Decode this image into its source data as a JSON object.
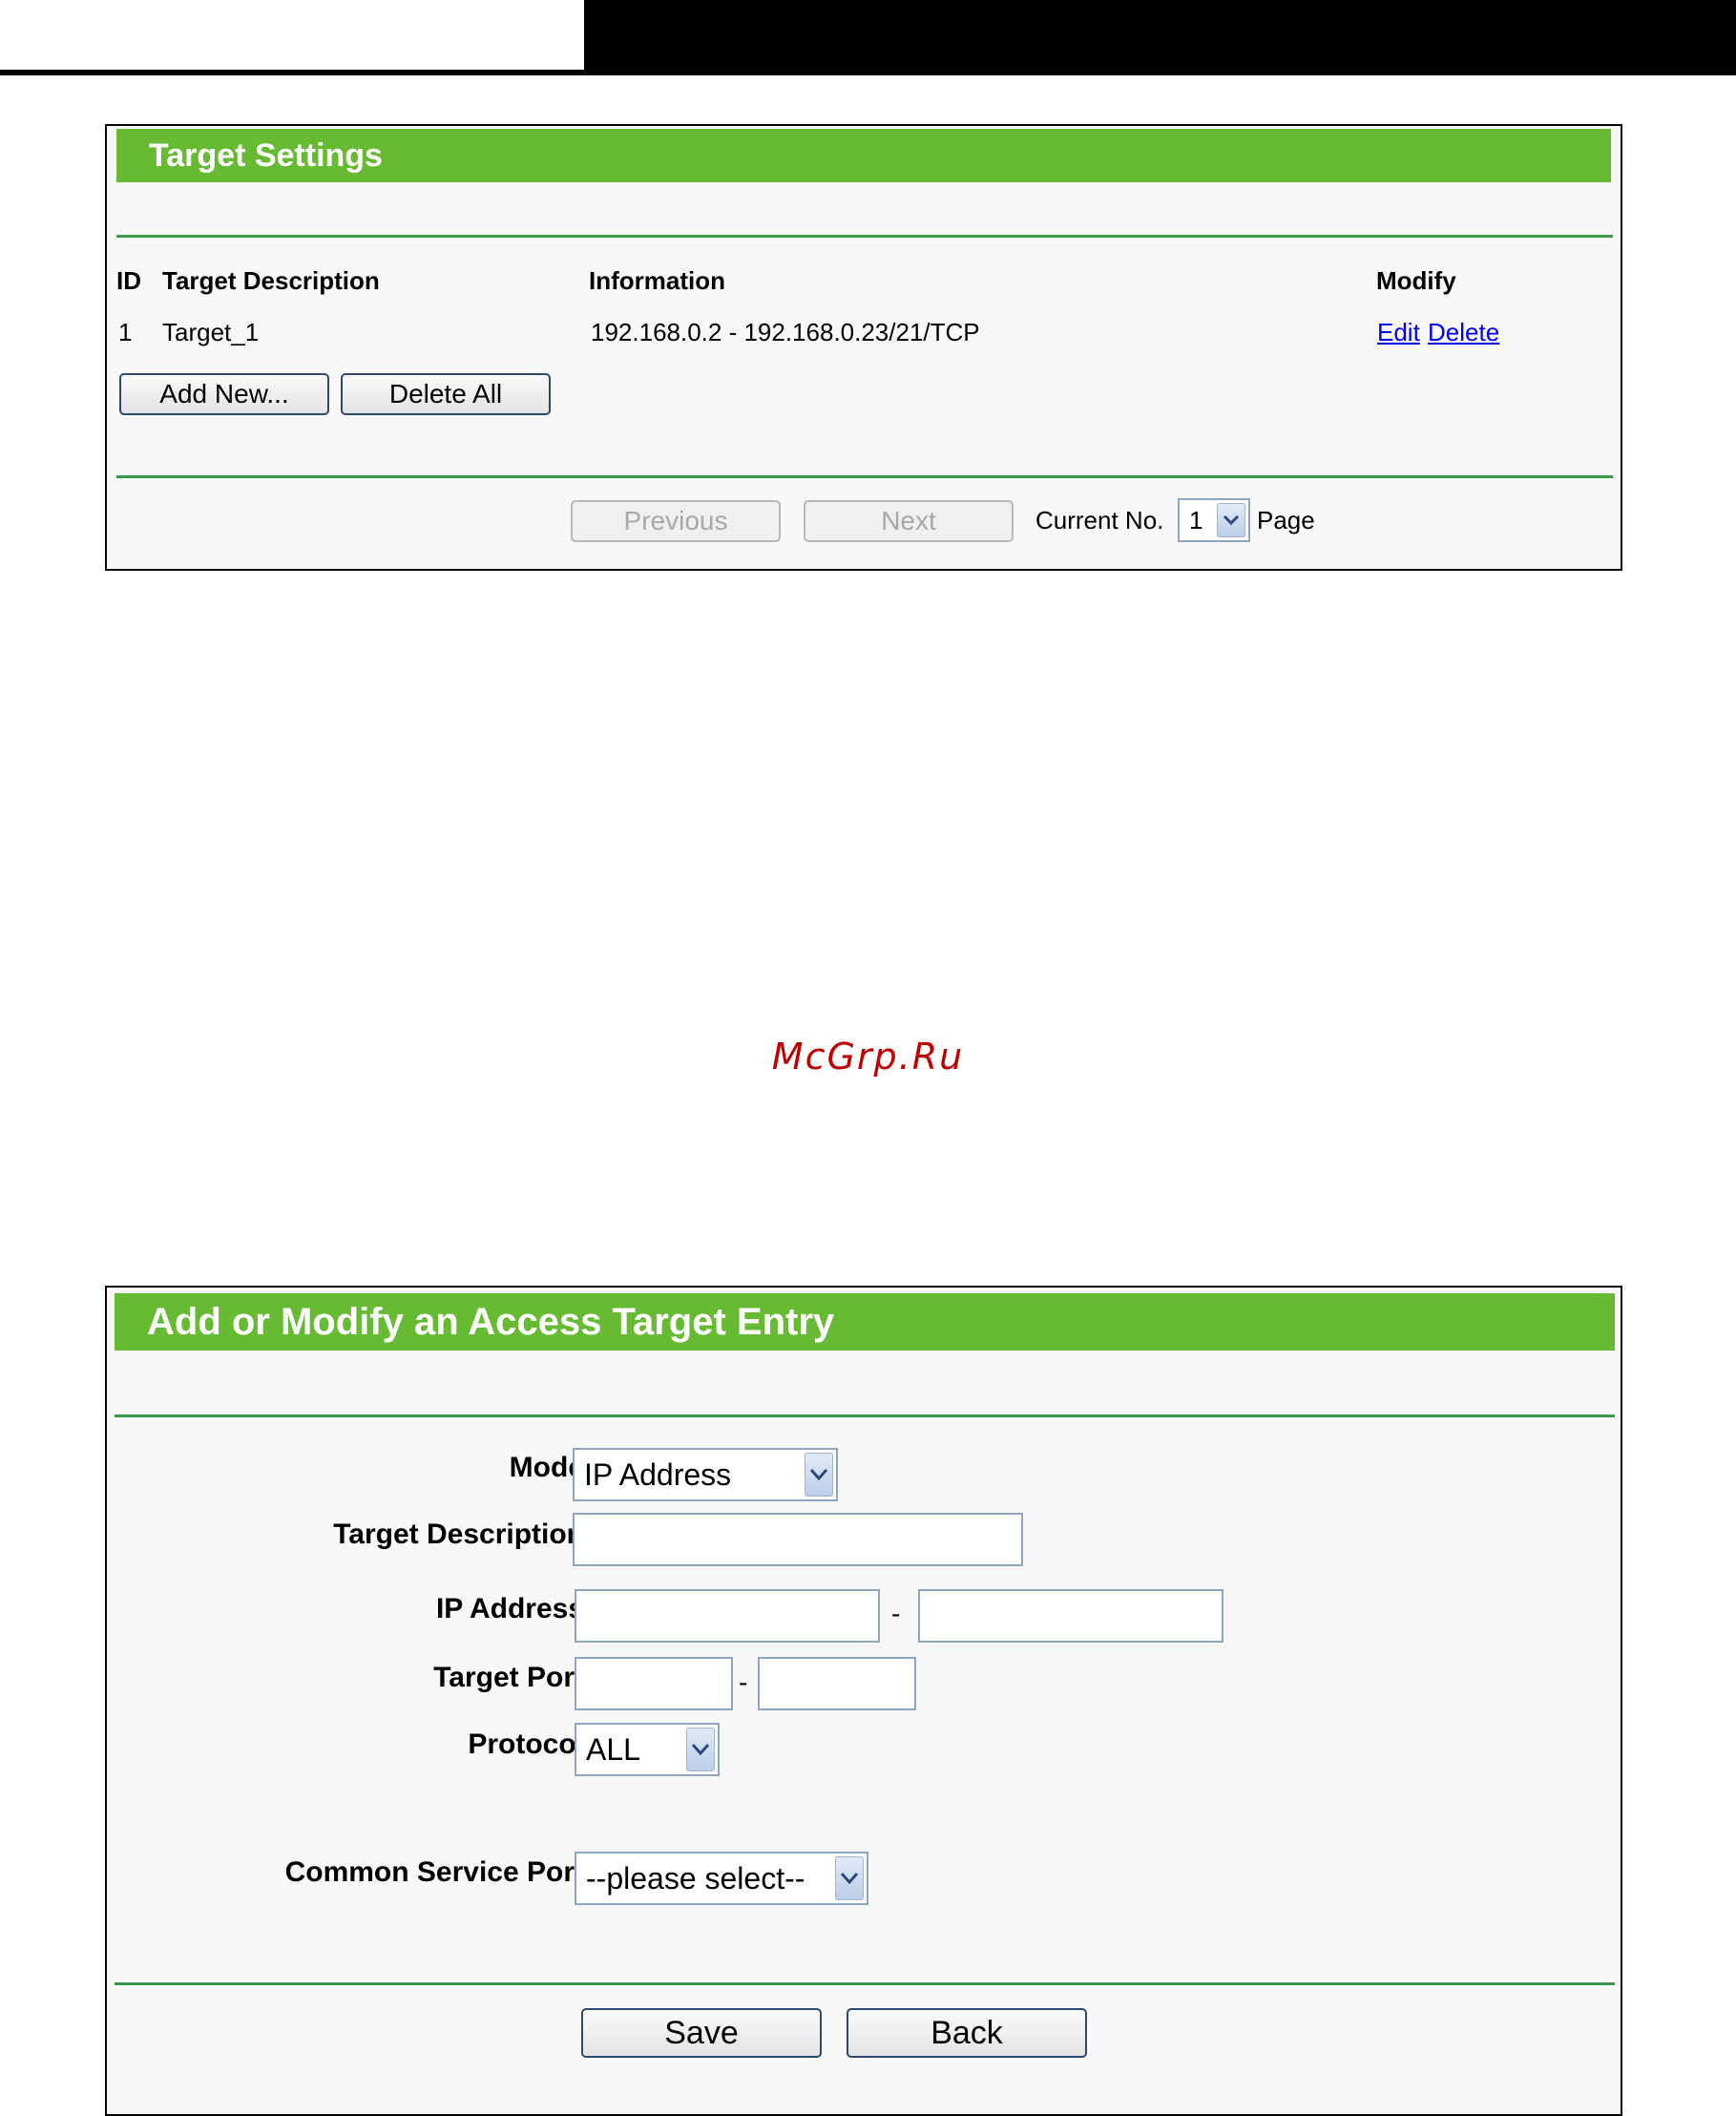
{
  "target_settings": {
    "title": "Target Settings",
    "columns": [
      "ID",
      "Target Description",
      "Information",
      "Modify"
    ],
    "rows": [
      {
        "id": "1",
        "description": "Target_1",
        "information": "192.168.0.2 - 192.168.0.23/21/TCP",
        "edit": "Edit",
        "delete": "Delete"
      }
    ],
    "add_new_label": "Add New...",
    "delete_all_label": "Delete All",
    "previous_label": "Previous",
    "next_label": "Next",
    "current_no_label": "Current No.",
    "page_value": "1",
    "page_label": "Page"
  },
  "watermark": "McGrp.Ru",
  "access_target_form": {
    "title": "Add or Modify an Access Target Entry",
    "mode_label": "Mode:",
    "mode_value": "IP Address",
    "target_description_label": "Target Description:",
    "target_description_value": "",
    "ip_address_label": "IP Address:",
    "ip_start_value": "",
    "ip_end_value": "",
    "separator": "-",
    "target_port_label": "Target Port:",
    "port_start_value": "",
    "port_end_value": "",
    "protocol_label": "Protocol:",
    "protocol_value": "ALL",
    "common_service_port_label": "Common Service Port:",
    "common_service_port_value": "--please select--",
    "save_label": "Save",
    "back_label": "Back"
  },
  "icons": {
    "dropdown": "chevron-down-icon"
  },
  "colors": {
    "title_bar": "#66bb33",
    "divider": "#3a9a4a",
    "link": "#0000ee"
  }
}
